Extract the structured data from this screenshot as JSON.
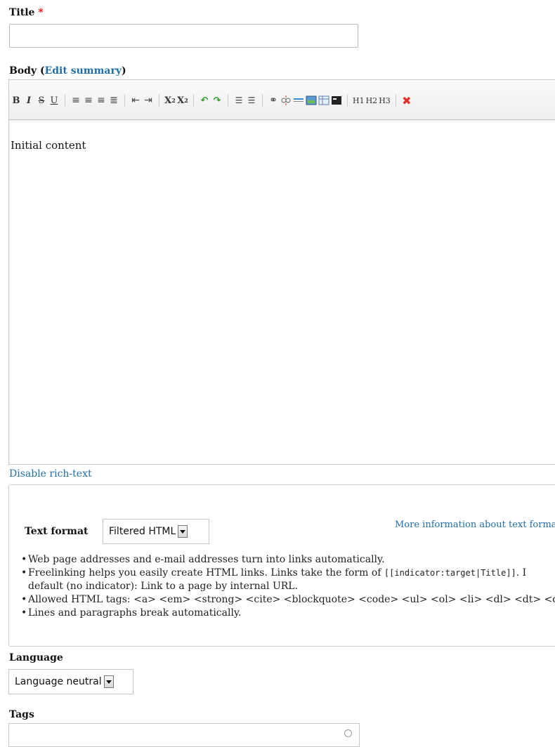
{
  "title_field": {
    "label": "Title",
    "required_marker": "*",
    "value": ""
  },
  "body_field": {
    "label_open": "Body (",
    "edit_summary": "Edit summary",
    "label_close": ")"
  },
  "toolbar": {
    "bold": "B",
    "italic": "I",
    "strike": "S",
    "underline": "U",
    "subscript": "X",
    "subscript_index": "2",
    "superscript": "X",
    "superscript_index": "2",
    "h1": "H1",
    "h2": "H2",
    "h3": "H3"
  },
  "editor": {
    "content": "Initial content"
  },
  "disable_rich_text": "Disable rich-text",
  "text_format": {
    "label": "Text format",
    "selected": "Filtered HTML",
    "more_info": "More information about text format",
    "tips": [
      "Web page addresses and e-mail addresses turn into links automatically.",
      "Freelinking helps you easily create HTML links. Links take the form of",
      "[[indicator:target|Title]]",
      ". I",
      "default (no indicator): Link to a page by internal URL.",
      "Allowed HTML tags: <a> <em> <strong> <cite> <blockquote> <code> <ul> <ol> <li> <dl> <dt> <dd>",
      "Lines and paragraphs break automatically."
    ]
  },
  "language": {
    "label": "Language",
    "selected": "Language neutral"
  },
  "tags": {
    "label": "Tags",
    "value": ""
  },
  "colors": {
    "link": "#1f6ea4",
    "required": "#e00000",
    "remove_format": "#e0332c",
    "undo_redo": "#2e9e2e"
  }
}
